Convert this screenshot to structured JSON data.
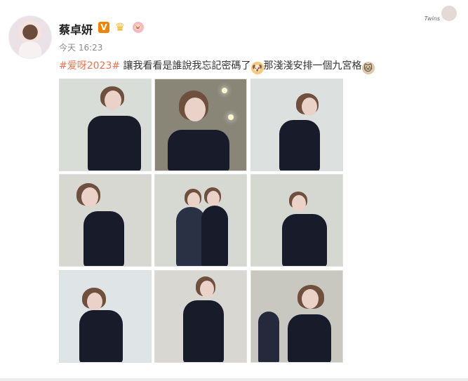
{
  "post": {
    "author": "蔡卓妍",
    "verified_badge": "V",
    "crown_badge": "♛",
    "pig_badge": "🐷",
    "time": "今天 16:23",
    "hashtag": "#爱呀2023#",
    "text_part1": " 讓我看看是誰說我忘記密碼了",
    "emoji_dog": "🐶",
    "text_part2": "那淺淺安排一個九宮格",
    "emoji_cat": "🐱"
  },
  "header": {
    "signature": "Twins"
  },
  "colors": {
    "tag": "#eb7350",
    "name": "#222222",
    "time": "#8a8a8a",
    "verified": "#f08300",
    "crown": "#f3b21f"
  },
  "photos": [
    {
      "name": "photo-1",
      "bg": "#d8ddd7"
    },
    {
      "name": "photo-2",
      "bg": "#8a8677"
    },
    {
      "name": "photo-3",
      "bg": "#dce1df"
    },
    {
      "name": "photo-4",
      "bg": "#d8d8d2"
    },
    {
      "name": "photo-5",
      "bg": "#d6d8d2"
    },
    {
      "name": "photo-6",
      "bg": "#d5d7d1"
    },
    {
      "name": "photo-7",
      "bg": "#dfe5e6"
    },
    {
      "name": "photo-8",
      "bg": "#d9d7d2"
    },
    {
      "name": "photo-9",
      "bg": "#c8c8c1"
    }
  ]
}
